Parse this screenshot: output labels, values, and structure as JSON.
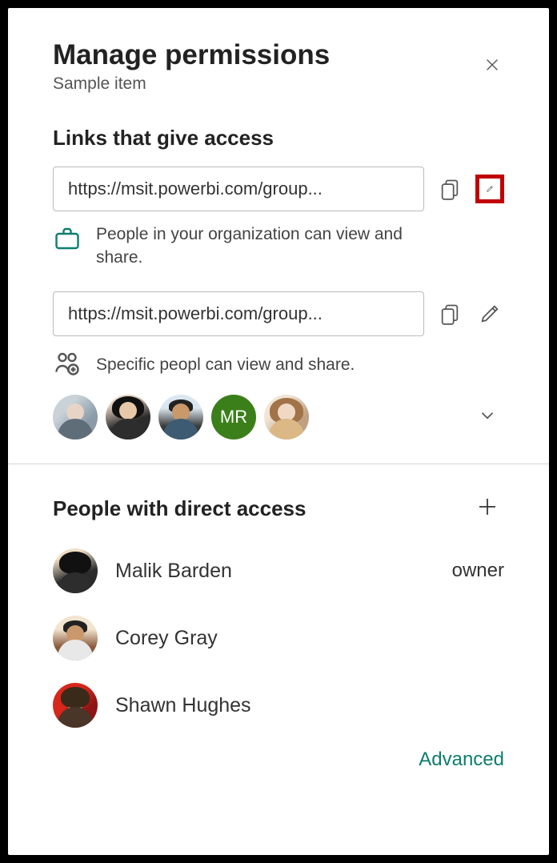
{
  "header": {
    "title": "Manage permissions",
    "subtitle": "Sample item"
  },
  "links_section": {
    "title": "Links that give access",
    "items": [
      {
        "url": "https://msit.powerbi.com/group...",
        "desc_icon": "briefcase-icon",
        "description": "People in your organization can view and share.",
        "highlight_edit": true
      },
      {
        "url": "https://msit.powerbi.com/group...",
        "desc_icon": "specific-people-icon",
        "description": "Specific peopl can view and share.",
        "avatars": [
          {
            "type": "photo",
            "label": "person-1"
          },
          {
            "type": "photo",
            "label": "person-2"
          },
          {
            "type": "photo",
            "label": "person-3"
          },
          {
            "type": "initials",
            "text": "MR"
          },
          {
            "type": "photo",
            "label": "person-5"
          }
        ]
      }
    ]
  },
  "direct_section": {
    "title": "People with direct access",
    "people": [
      {
        "name": "Malik Barden",
        "role": "owner"
      },
      {
        "name": "Corey Gray",
        "role": ""
      },
      {
        "name": "Shawn Hughes",
        "role": ""
      }
    ]
  },
  "footer": {
    "advanced_label": "Advanced"
  }
}
